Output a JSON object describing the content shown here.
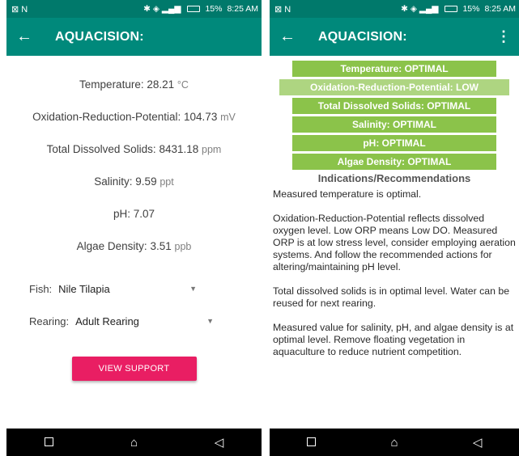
{
  "status_bar": {
    "left_icons": "⊠ N",
    "time": "8:25 AM",
    "battery": "15%"
  },
  "app": {
    "title": "AQUACISION:"
  },
  "readings": [
    {
      "label": "Temperature:",
      "value": "28.21",
      "unit": "°C"
    },
    {
      "label": "Oxidation-Reduction-Potential:",
      "value": "104.73",
      "unit": "mV"
    },
    {
      "label": "Total Dissolved Solids:",
      "value": "8431.18",
      "unit": "ppm"
    },
    {
      "label": "Salinity:",
      "value": "9.59",
      "unit": "ppt"
    },
    {
      "label": "pH:",
      "value": "7.07",
      "unit": ""
    },
    {
      "label": "Algae Density:",
      "value": "3.51",
      "unit": "ppb"
    }
  ],
  "spinners": {
    "fish": {
      "label": "Fish:",
      "value": "Nile Tilapia"
    },
    "rearing": {
      "label": "Rearing:",
      "value": "Adult Rearing"
    }
  },
  "button": {
    "view_support": "VIEW SUPPORT"
  },
  "statuses": [
    {
      "text": "Temperature: OPTIMAL",
      "level": "optimal"
    },
    {
      "text": "Oxidation-Reduction-Potential: LOW",
      "level": "low"
    },
    {
      "text": "Total Dissolved Solids: OPTIMAL",
      "level": "optimal"
    },
    {
      "text": "Salinity: OPTIMAL",
      "level": "optimal"
    },
    {
      "text": "pH: OPTIMAL",
      "level": "optimal"
    },
    {
      "text": "Algae Density: OPTIMAL",
      "level": "optimal"
    }
  ],
  "recommendations": {
    "title": "Indications/Recommendations",
    "paragraphs": [
      "Measured temperature is optimal.",
      "Oxidation-Reduction-Potential reflects dissolved oxygen level. Low ORP means Low DO. Measured ORP is at low stress level, consider employing aeration systems. And follow the recommended actions for altering/maintaining pH level.",
      "Total dissolved solids is in optimal level. Water can be reused for next rearing.",
      "Measured value for salinity, pH, and algae density is at optimal level. Remove floating vegetation in aquaculture to reduce nutrient competition."
    ]
  },
  "colors": {
    "status_bar": "#00796b",
    "app_bar": "#00897b",
    "optimal": "#8bc34a",
    "low": "#aed581",
    "button": "#e91e63"
  },
  "icons": {
    "back": "arrow-left-icon",
    "menu": "more-vert-icon",
    "nav": [
      "recents-icon",
      "home-icon",
      "back-triangle-icon"
    ]
  }
}
